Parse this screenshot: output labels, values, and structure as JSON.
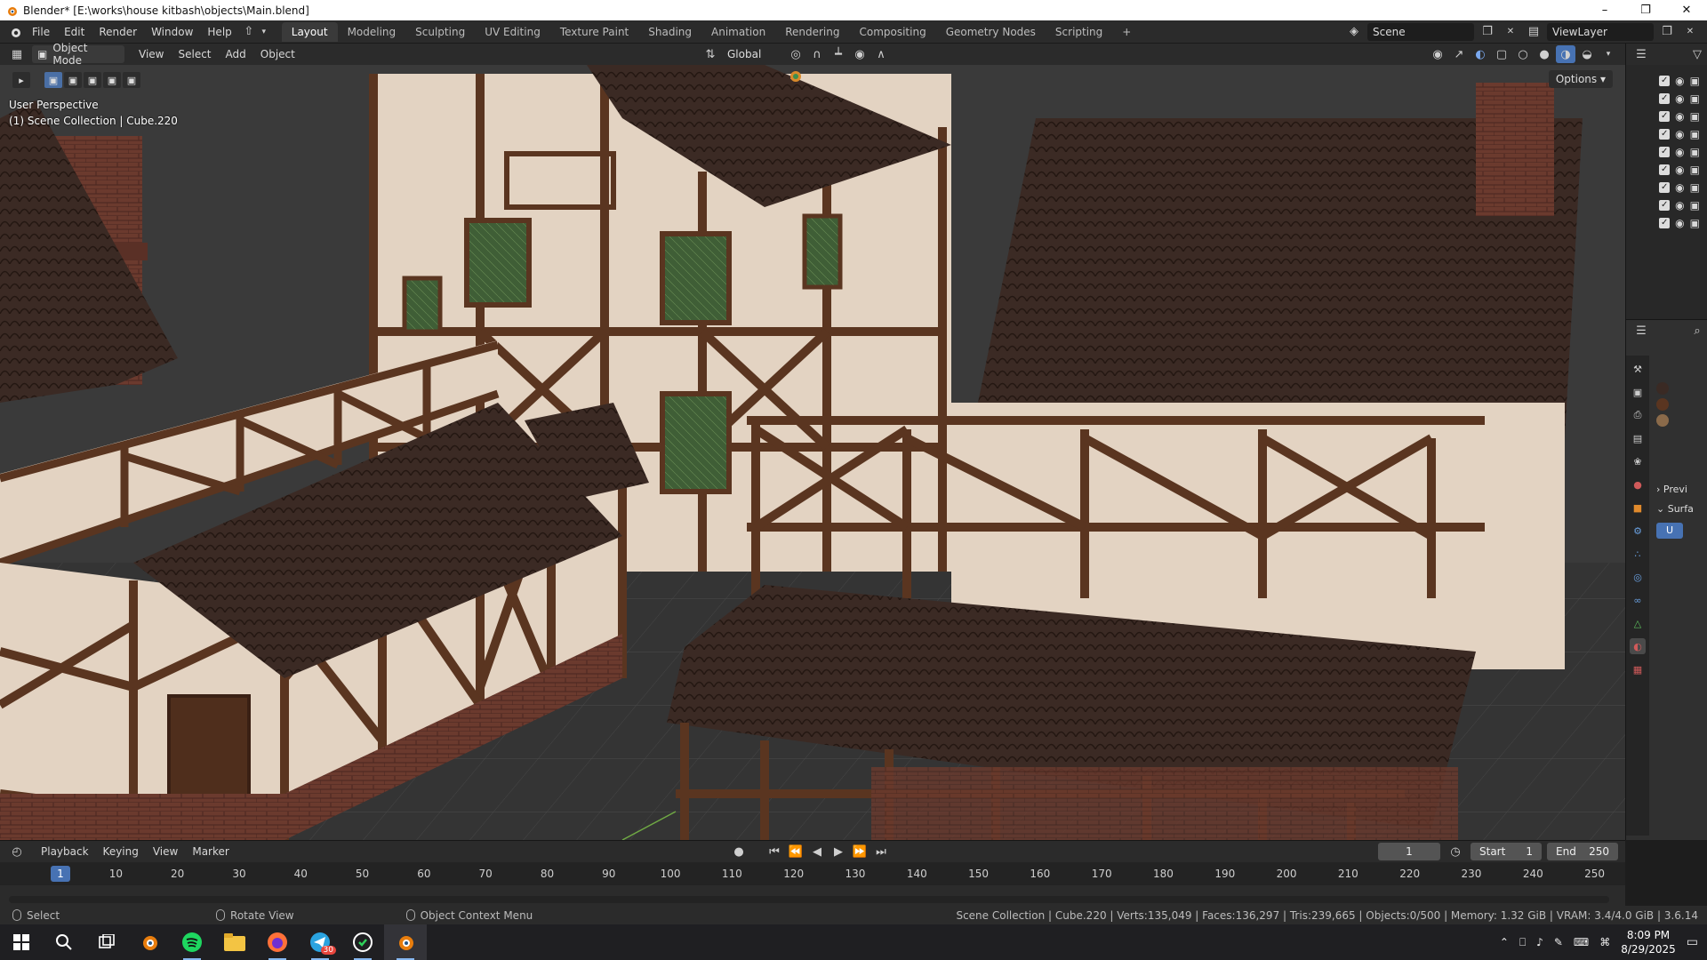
{
  "window": {
    "title": "Blender* [E:\\works\\house kitbash\\objects\\Main.blend]",
    "controls": [
      "minimize-icon",
      "restore-icon",
      "close-icon"
    ]
  },
  "menu": {
    "items": [
      "File",
      "Edit",
      "Render",
      "Window",
      "Help"
    ]
  },
  "workspaces": [
    "Layout",
    "Modeling",
    "Sculpting",
    "UV Editing",
    "Texture Paint",
    "Shading",
    "Animation",
    "Rendering",
    "Compositing",
    "Geometry Nodes",
    "Scripting"
  ],
  "active_workspace": "Layout",
  "scene": {
    "name": "Scene",
    "view_layer": "ViewLayer"
  },
  "viewport_header": {
    "mode": "Object Mode",
    "menus": [
      "View",
      "Select",
      "Add",
      "Object"
    ],
    "orientation": "Global"
  },
  "viewport": {
    "perspective_label": "User Perspective",
    "collection_label": "(1) Scene Collection | Cube.220",
    "options_label": "Options"
  },
  "outliner": {
    "row_count": 9
  },
  "properties": {
    "panel_labels": [
      "Previ",
      "Surfa"
    ],
    "slot_label": "U"
  },
  "timeline": {
    "menus": [
      "Playback",
      "Keying",
      "View",
      "Marker"
    ],
    "current_frame": "1",
    "start_label": "Start",
    "start": "1",
    "end_label": "End",
    "end": "250",
    "ticks": [
      "10",
      "20",
      "30",
      "40",
      "50",
      "60",
      "70",
      "80",
      "90",
      "100",
      "110",
      "120",
      "130",
      "140",
      "150",
      "160",
      "170",
      "180",
      "190",
      "200",
      "210",
      "220",
      "230",
      "240",
      "250"
    ],
    "playhead_label": "1"
  },
  "statusbar": {
    "hints": [
      {
        "icon": "mouse-left-icon",
        "label": "Select"
      },
      {
        "icon": "mouse-middle-icon",
        "label": "Rotate View"
      },
      {
        "icon": "mouse-right-icon",
        "label": "Object Context Menu"
      }
    ],
    "stats": "Scene Collection | Cube.220 | Verts:135,049 | Faces:136,297 | Tris:239,665 | Objects:0/500 | Memory: 1.32 GiB | VRAM: 3.4/4.0 GiB | 3.6.14"
  },
  "taskbar": {
    "apps": [
      "windows-start-icon",
      "search-icon",
      "task-view-icon",
      "blender-app-icon",
      "spotify-icon",
      "file-explorer-icon",
      "firefox-icon",
      "telegram-icon",
      "whatsapp-icon",
      "blender-active-icon"
    ],
    "telegram_badge": "30",
    "time": "8:09 PM",
    "date": "8/29/2025"
  },
  "colors": {
    "accent": "#4772b3",
    "panel": "#2b2b2b",
    "roof": "#3b2a24",
    "timber": "#5a3520",
    "plaster": "#e3d3c2",
    "brick": "#6b3a2e"
  }
}
